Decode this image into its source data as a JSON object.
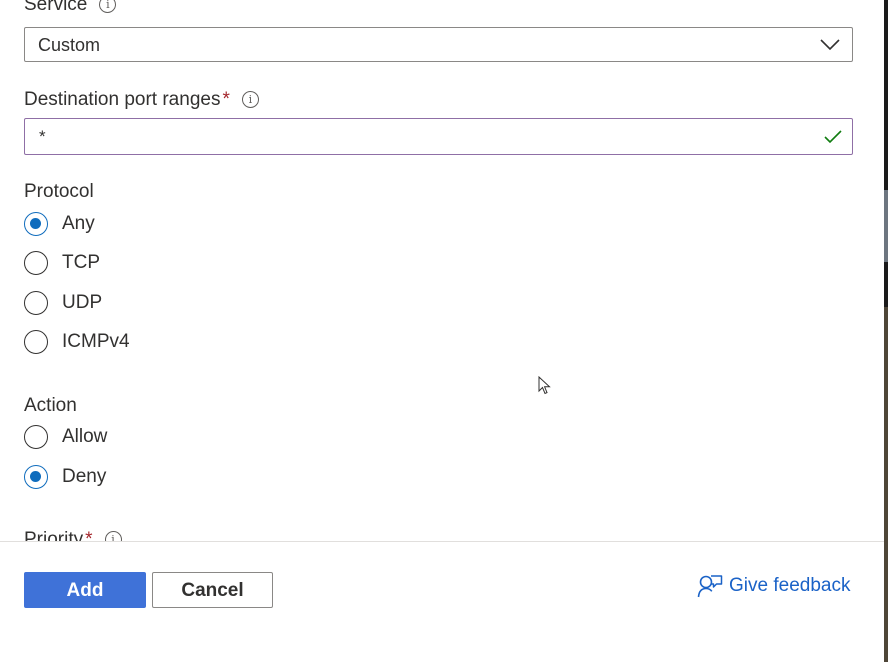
{
  "service": {
    "label": "Service",
    "value": "Custom",
    "icons": [
      "info-icon",
      "chevron-down-icon"
    ]
  },
  "destination_port_ranges": {
    "label": "Destination port ranges",
    "required_mark": "*",
    "value": "*",
    "valid": true,
    "icons": [
      "info-icon",
      "checkmark-icon"
    ]
  },
  "protocol": {
    "label": "Protocol",
    "options": [
      {
        "label": "Any",
        "checked": true
      },
      {
        "label": "TCP",
        "checked": false
      },
      {
        "label": "UDP",
        "checked": false
      },
      {
        "label": "ICMPv4",
        "checked": false
      }
    ]
  },
  "action": {
    "label": "Action",
    "options": [
      {
        "label": "Allow",
        "checked": false
      },
      {
        "label": "Deny",
        "checked": true
      }
    ]
  },
  "priority": {
    "label": "Priority",
    "required_mark": "*"
  },
  "footer": {
    "add_label": "Add",
    "cancel_label": "Cancel",
    "feedback_label": "Give feedback"
  },
  "colors": {
    "accent": "#0f6cbd",
    "primary_button": "#3f72d8",
    "link": "#1a62c7",
    "required": "#a4262c",
    "valid_check": "#107c10",
    "input_focus_border": "#8f6fa6"
  }
}
